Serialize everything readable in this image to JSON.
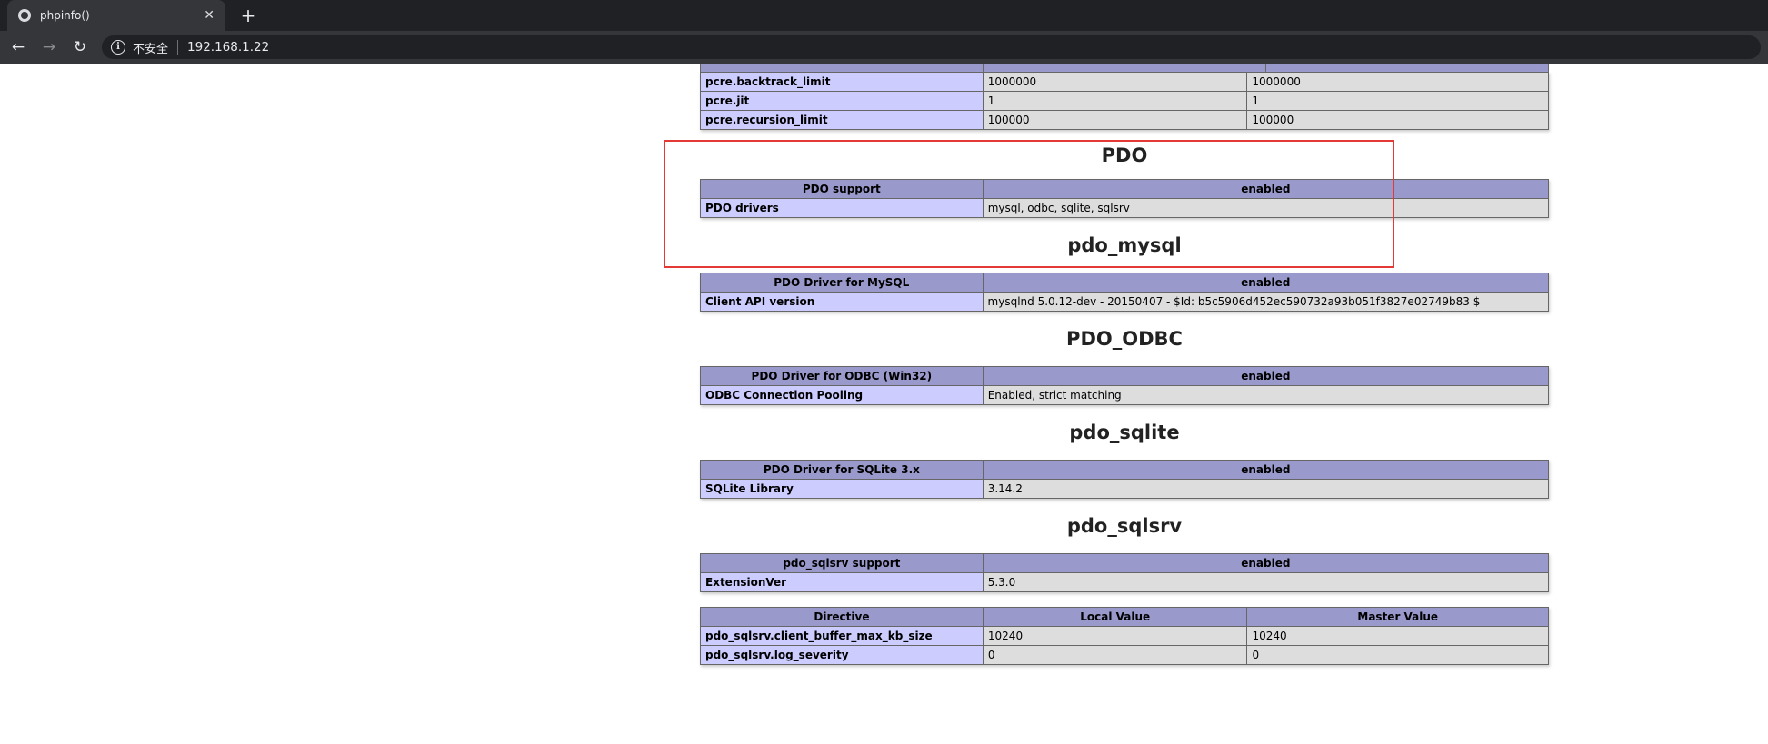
{
  "browser": {
    "tab_title": "phpinfo()",
    "new_tab": "+",
    "close": "✕",
    "security_label": "不安全",
    "url": "192.168.1.22"
  },
  "top_table": [
    {
      "directive": "pcre.backtrack_limit",
      "local": "1000000",
      "master": "1000000"
    },
    {
      "directive": "pcre.jit",
      "local": "1",
      "master": "1"
    },
    {
      "directive": "pcre.recursion_limit",
      "local": "100000",
      "master": "100000"
    }
  ],
  "sections": {
    "pdo": {
      "title": "PDO",
      "header": [
        "PDO support",
        "enabled"
      ],
      "rows": [
        [
          "PDO drivers",
          "mysql, odbc, sqlite, sqlsrv"
        ]
      ]
    },
    "pdo_mysql": {
      "title": "pdo_mysql",
      "header": [
        "PDO Driver for MySQL",
        "enabled"
      ],
      "rows": [
        [
          "Client API version",
          "mysqlnd 5.0.12-dev - 20150407 - $Id: b5c5906d452ec590732a93b051f3827e02749b83 $"
        ]
      ]
    },
    "pdo_odbc": {
      "title": "PDO_ODBC",
      "header": [
        "PDO Driver for ODBC (Win32)",
        "enabled"
      ],
      "rows": [
        [
          "ODBC Connection Pooling",
          "Enabled, strict matching"
        ]
      ]
    },
    "pdo_sqlite": {
      "title": "pdo_sqlite",
      "header": [
        "PDO Driver for SQLite 3.x",
        "enabled"
      ],
      "rows": [
        [
          "SQLite Library",
          "3.14.2"
        ]
      ]
    },
    "pdo_sqlsrv": {
      "title": "pdo_sqlsrv",
      "header": [
        "pdo_sqlsrv support",
        "enabled"
      ],
      "rows": [
        [
          "ExtensionVer",
          "5.3.0"
        ]
      ],
      "directives_header": [
        "Directive",
        "Local Value",
        "Master Value"
      ],
      "directives": [
        [
          "pdo_sqlsrv.client_buffer_max_kb_size",
          "10240",
          "10240"
        ],
        [
          "pdo_sqlsrv.log_severity",
          "0",
          "0"
        ]
      ]
    }
  },
  "colors": {
    "header_bg": "#9999cc",
    "key_bg": "#ccccff",
    "value_bg": "#dddddd",
    "highlight_border": "#e53935"
  }
}
